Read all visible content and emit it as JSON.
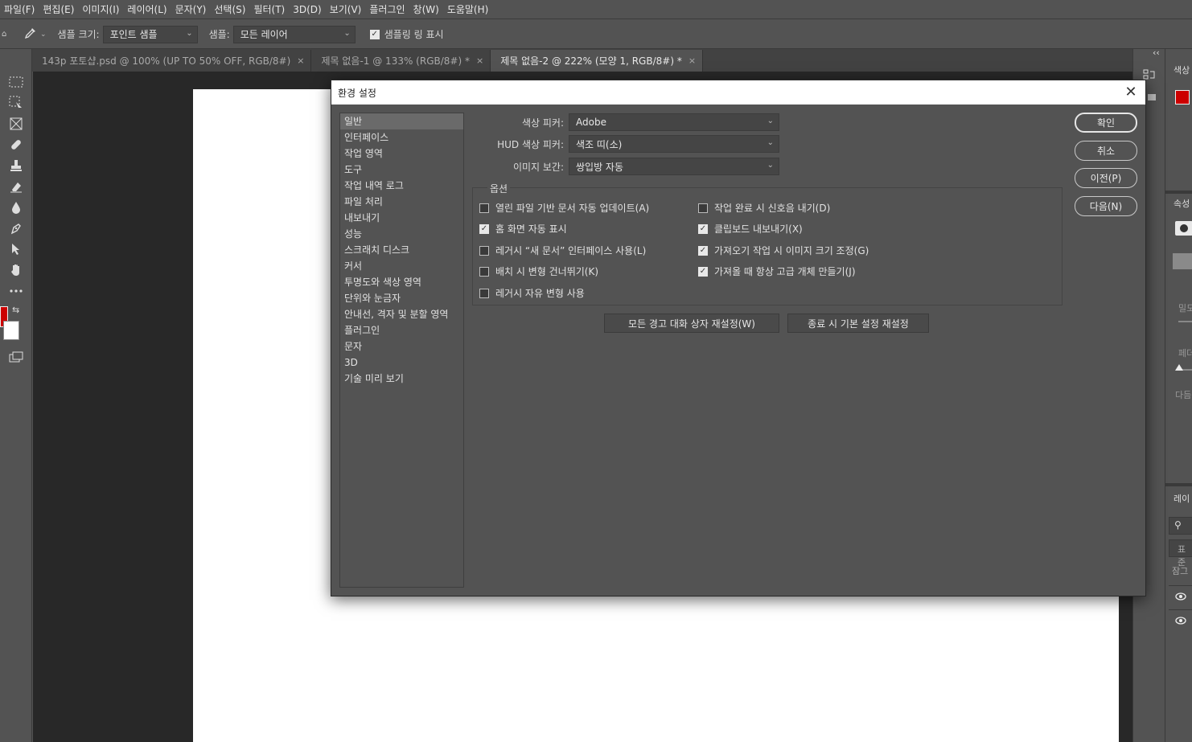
{
  "menu": [
    "파일(F)",
    "편집(E)",
    "이미지(I)",
    "레이어(L)",
    "문자(Y)",
    "선택(S)",
    "필터(T)",
    "3D(D)",
    "보기(V)",
    "플러그인",
    "창(W)",
    "도움말(H)"
  ],
  "options_bar": {
    "sample_size_label": "샘플 크기:",
    "sample_size_value": "포인트 샘플",
    "sample_label": "샘플:",
    "sample_value": "모든 레이어",
    "show_ring_label": "샘플링 링 표시"
  },
  "tabs": [
    {
      "label": "143p 포토샵.psd @ 100% (UP TO 50% OFF, RGB/8#)",
      "close": "×"
    },
    {
      "label": "제목 없음-1 @ 133% (RGB/8#) *",
      "close": "×"
    },
    {
      "label": "제목 없음-2 @ 222% (모양 1, RGB/8#) *",
      "close": "×"
    }
  ],
  "right_panel": {
    "collapse": "‹‹",
    "color_title": "색상",
    "properties_title": "속성",
    "opacity_label": "밀도",
    "feather_label": "페더",
    "next_label": "다듬",
    "layers_title": "레이",
    "kind_label": "표준",
    "lock_label": "잠그"
  },
  "colors": {
    "foreground": "#cc0000",
    "background": "#ffffff"
  },
  "dialog": {
    "title": "환경 설정",
    "close": "✕",
    "categories": [
      "일반",
      "인터페이스",
      "작업 영역",
      "도구",
      "작업 내역 로그",
      "파일 처리",
      "내보내기",
      "성능",
      "스크래치 디스크",
      "커서",
      "투명도와 색상 영역",
      "단위와 눈금자",
      "안내선, 격자 및 분할 영역",
      "플러그인",
      "문자",
      "3D",
      "기술 미리 보기"
    ],
    "selected_category": 0,
    "fields": [
      {
        "label": "색상 피커:",
        "value": "Adobe"
      },
      {
        "label": "HUD 색상 피커:",
        "value": "색조 띠(소)"
      },
      {
        "label": "이미지 보간:",
        "value": "쌍입방 자동"
      }
    ],
    "options_legend": "옵션",
    "options_left": [
      {
        "label": "열린 파일 기반 문서 자동 업데이트(A)",
        "checked": false
      },
      {
        "label": "홈 화면 자동 표시",
        "checked": true
      },
      {
        "label": "레거시 “새 문서” 인터페이스 사용(L)",
        "checked": false
      },
      {
        "label": "배치 시 변형 건너뛰기(K)",
        "checked": false
      },
      {
        "label": "레거시 자유 변형 사용",
        "checked": false
      }
    ],
    "options_right": [
      {
        "label": "작업 완료 시 신호음 내기(D)",
        "checked": false
      },
      {
        "label": "클립보드 내보내기(X)",
        "checked": true
      },
      {
        "label": "가져오기 작업 시 이미지 크기 조정(G)",
        "checked": true
      },
      {
        "label": "가져올 때 항상 고급 개체 만들기(J)",
        "checked": true
      }
    ],
    "reset_warnings": "모든 경고 대화 상자 재설정(W)",
    "reset_prefs": "종료 시 기본 설정 재설정",
    "buttons": {
      "ok": "확인",
      "cancel": "취소",
      "prev": "이전(P)",
      "next": "다음(N)"
    }
  }
}
